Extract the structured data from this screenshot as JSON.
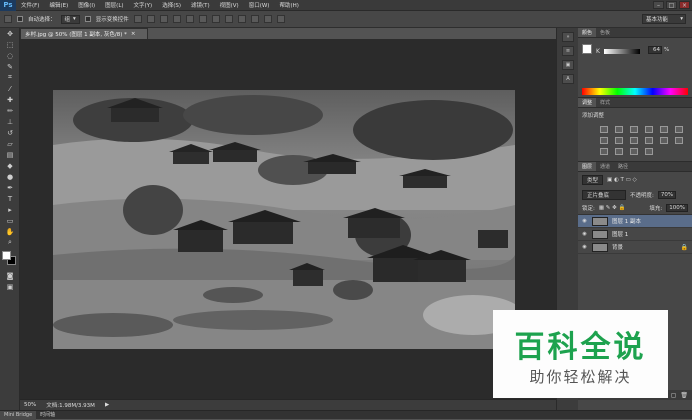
{
  "menubar": {
    "logo": "Ps",
    "items": [
      "文件(F)",
      "编辑(E)",
      "图像(I)",
      "图层(L)",
      "文字(Y)",
      "选择(S)",
      "滤镜(T)",
      "视图(V)",
      "窗口(W)",
      "帮助(H)"
    ],
    "minimize": "–",
    "maximize": "□",
    "close": "×"
  },
  "options": {
    "auto_select_label": "自动选择：",
    "auto_select_value": "组",
    "show_transform_label": "显示变换控件",
    "workspace": "基本功能"
  },
  "document": {
    "tab_title": "乡村.jpg @ 50% (图层 1 副本, 灰色/8) *",
    "tab_close": "×"
  },
  "status": {
    "zoom": "50%",
    "doc_info": "文档:1.98M/3.93M",
    "arrow": "▶"
  },
  "bottom_tabs": [
    "Mini Bridge",
    "时间轴"
  ],
  "color_panel": {
    "tabs": [
      "颜色",
      "色板"
    ],
    "slider_label": "K",
    "value": "64",
    "percent": "%"
  },
  "adjust_panel": {
    "tabs": [
      "调整",
      "样式"
    ],
    "title": "添加调整"
  },
  "layers_panel": {
    "tabs": [
      "图层",
      "通道",
      "路径"
    ],
    "kind_label": "类型",
    "blend_mode": "正片叠底",
    "opacity_label": "不透明度:",
    "opacity_value": "70%",
    "lock_label": "锁定:",
    "fill_label": "填充:",
    "fill_value": "100%",
    "layers": [
      {
        "name": "图层 1 副本",
        "selected": true
      },
      {
        "name": "图层 1",
        "selected": false
      },
      {
        "name": "背景",
        "selected": false
      }
    ]
  },
  "dock": {
    "buttons": [
      "»",
      "≡",
      "▣",
      "A"
    ]
  },
  "watermark": {
    "title": "百科全说",
    "subtitle": "助你轻松解决"
  },
  "colors": {
    "watermark_green": "#1da24e",
    "selected_layer": "#5a6d8a"
  },
  "photo": {
    "description_hidden": true
  }
}
